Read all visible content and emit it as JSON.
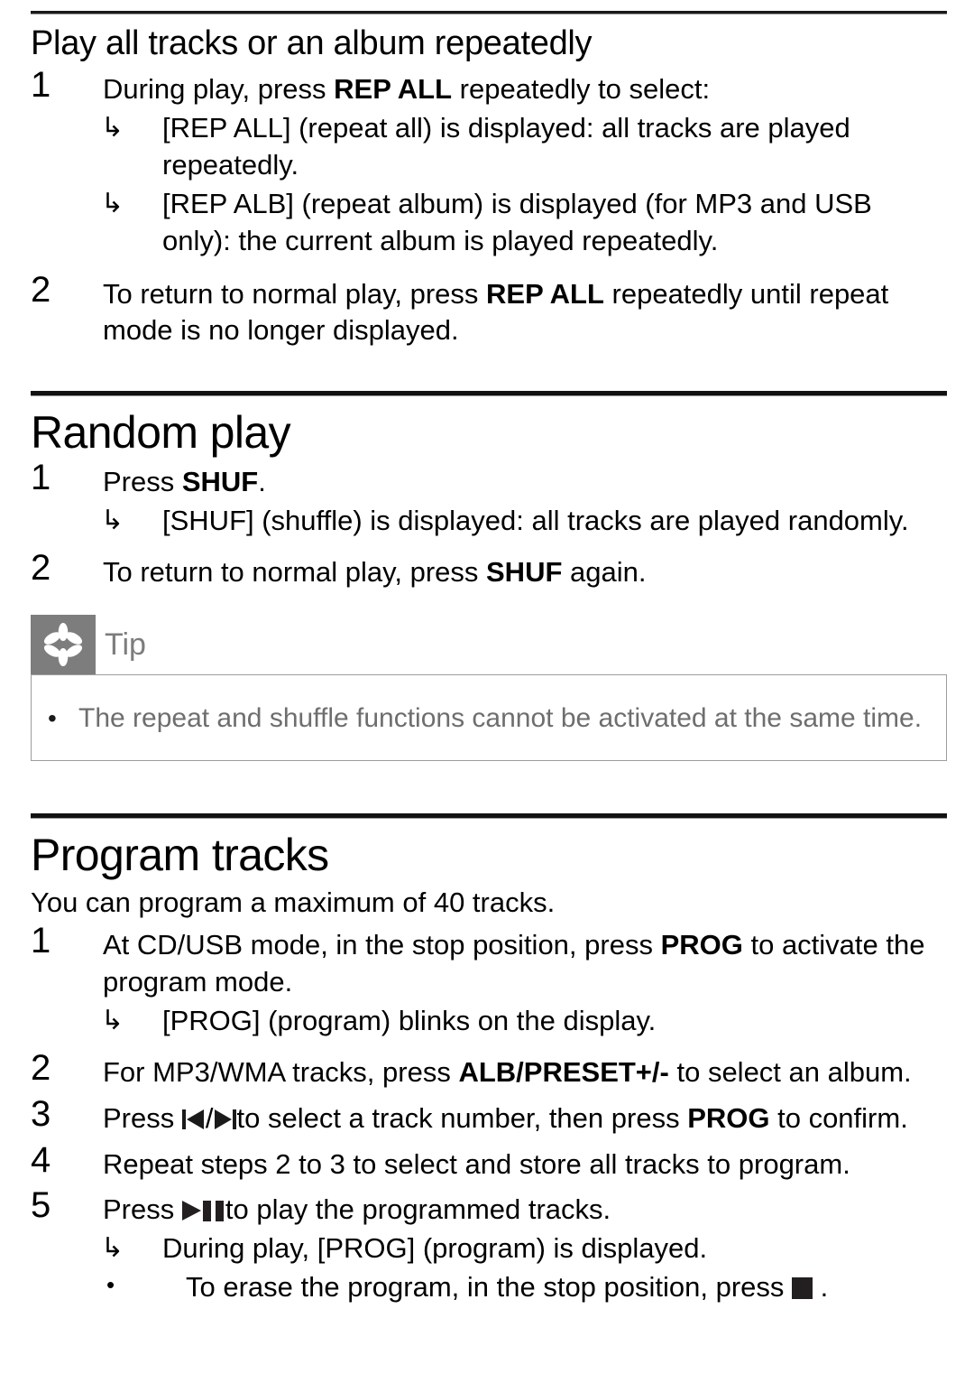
{
  "sections": [
    {
      "id": "repeat",
      "heading": "Play all tracks or an album repeatedly",
      "steps": [
        {
          "num": "1",
          "text_before": "During play, press ",
          "bold": "REP ALL",
          "text_after": " repeatedly to select:",
          "subs": [
            {
              "mark": "↳",
              "text": "[REP ALL] (repeat all) is displayed: all tracks are played repeatedly."
            },
            {
              "mark": "↳",
              "text": "[REP ALB] (repeat album) is displayed (for MP3 and USB only): the current album is played repeatedly."
            }
          ]
        },
        {
          "num": "2",
          "text_before": "To return to normal play, press ",
          "bold": "REP ALL",
          "text_after": " repeatedly until repeat mode is no longer displayed.",
          "subs": []
        }
      ]
    },
    {
      "id": "random",
      "heading": "Random play",
      "steps": [
        {
          "num": "1",
          "text_before": "Press ",
          "bold": "SHUF",
          "text_after": ".",
          "subs": [
            {
              "mark": "↳",
              "text": "[SHUF] (shuffle) is displayed: all tracks are played randomly."
            }
          ]
        },
        {
          "num": "2",
          "text_before": "To return to normal play, press ",
          "bold": "SHUF",
          "text_after": " again.",
          "subs": []
        }
      ]
    },
    {
      "id": "program",
      "heading": "Program tracks",
      "intro": "You can program a maximum of 40 tracks.",
      "steps": [
        {
          "num": "1",
          "text_before": "At CD/USB mode, in the stop position, press ",
          "bold": "PROG",
          "text_after": " to activate the program mode.",
          "subs": [
            {
              "mark": "↳",
              "text": "[PROG] (program) blinks on the display."
            }
          ]
        },
        {
          "num": "2",
          "text_before": "For MP3/WMA tracks, press ",
          "bold": "ALB/PRESET+/-",
          "text_after": " to select an album.",
          "subs": []
        },
        {
          "num": "3",
          "text_before": "Press ",
          "icons": [
            "prev-track-icon",
            "slash",
            "next-track-icon"
          ],
          "text_mid": "to select a track number, then press ",
          "bold": "PROG",
          "text_after": " to confirm.",
          "subs": []
        },
        {
          "num": "4",
          "text_before": "Repeat steps 2 to 3 to select and store all tracks to program.",
          "subs": []
        },
        {
          "num": "5",
          "text_before": "Press ",
          "icons": [
            "play-icon",
            "pause-icon"
          ],
          "text_mid": "to play the programmed tracks.",
          "subs": [
            {
              "mark": "↳",
              "text": "During play, [PROG] (program) is displayed."
            },
            {
              "mark": "•",
              "text_before": "To erase the program, in the stop position, press ",
              "icon": "stop-icon",
              "text_after": " ."
            }
          ]
        }
      ]
    }
  ],
  "tip": {
    "icon": "asterisk-flower-icon",
    "label": "Tip",
    "bullet": "•",
    "items": [
      "The repeat and shuffle functions cannot be activated at the same time."
    ]
  },
  "colors": {
    "tip_gray": "#7d7d7d",
    "tip_text": "#6e6e6e",
    "tip_border": "#9d9d9d",
    "rule": "#1a1a1a",
    "ink": "#000000"
  },
  "glyphs": {
    "arrow_sub": "↳",
    "bullet": "•",
    "slash": "/"
  }
}
